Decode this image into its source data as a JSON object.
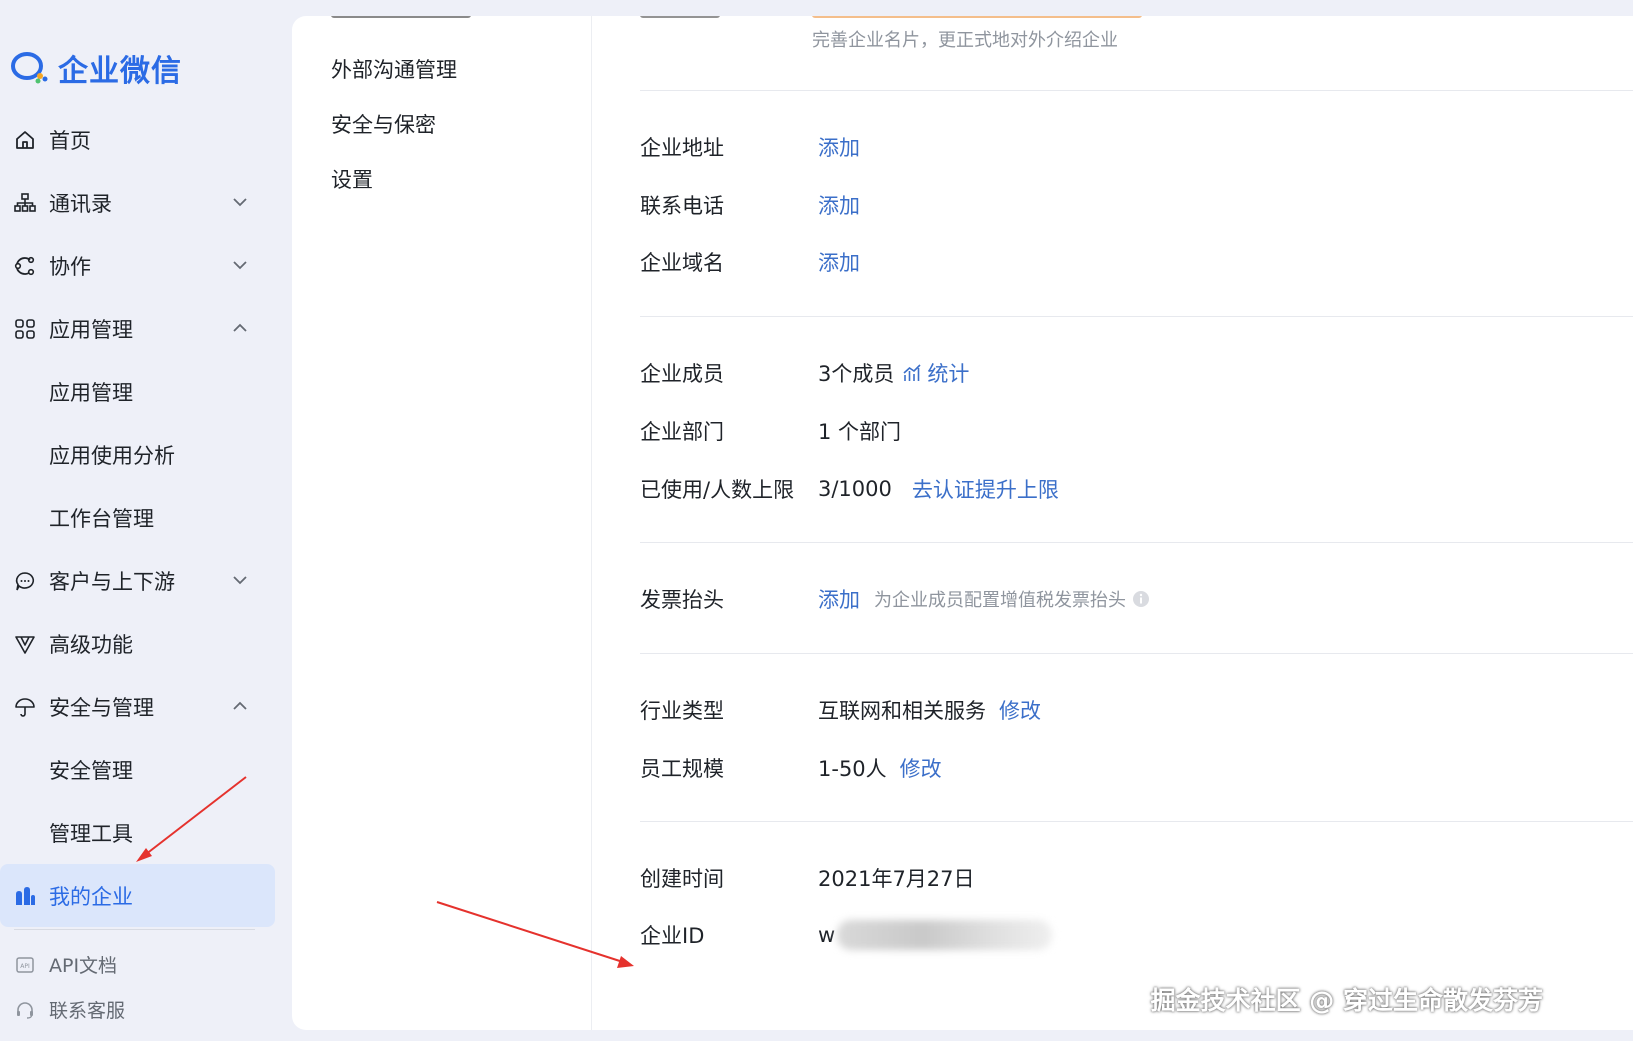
{
  "app": {
    "name": "企业微信"
  },
  "sidebar": {
    "items": [
      {
        "label": "首页"
      },
      {
        "label": "通讯录"
      },
      {
        "label": "协作"
      },
      {
        "label": "应用管理"
      },
      {
        "label": "应用管理"
      },
      {
        "label": "应用使用分析"
      },
      {
        "label": "工作台管理"
      },
      {
        "label": "客户与上下游"
      },
      {
        "label": "高级功能"
      },
      {
        "label": "安全与管理"
      },
      {
        "label": "安全管理"
      },
      {
        "label": "管理工具"
      },
      {
        "label": "我的企业"
      }
    ],
    "bottom": [
      {
        "label": "API文档"
      },
      {
        "label": "联系客服"
      }
    ]
  },
  "subnav": {
    "items": [
      {
        "label": "外部沟通管理"
      },
      {
        "label": "安全与保密"
      },
      {
        "label": "设置"
      }
    ]
  },
  "content": {
    "card_hint": "完善企业名片，更正式地对外介绍企业",
    "address": {
      "label": "企业地址",
      "action": "添加"
    },
    "phone": {
      "label": "联系电话",
      "action": "添加"
    },
    "domain": {
      "label": "企业域名",
      "action": "添加"
    },
    "members": {
      "label": "企业成员",
      "value": "3个成员",
      "action": "统计"
    },
    "departments": {
      "label": "企业部门",
      "value": "1 个部门"
    },
    "limit": {
      "label": "已使用/人数上限",
      "value": "3/1000",
      "action": "去认证提升上限"
    },
    "invoice": {
      "label": "发票抬头",
      "action": "添加",
      "hint": "为企业成员配置增值税发票抬头"
    },
    "industry": {
      "label": "行业类型",
      "value": "互联网和相关服务",
      "action": "修改"
    },
    "scale": {
      "label": "员工规模",
      "value": "1-50人",
      "action": "修改"
    },
    "created": {
      "label": "创建时间",
      "value": "2021年7月27日"
    },
    "corp_id": {
      "label": "企业ID",
      "value": "w"
    }
  },
  "watermark": "掘金技术社区 @ 穿过生命散发芬芳",
  "colors": {
    "accent": "#2b6be5",
    "link": "#3b6fc9",
    "annotation": "#e5322d"
  }
}
